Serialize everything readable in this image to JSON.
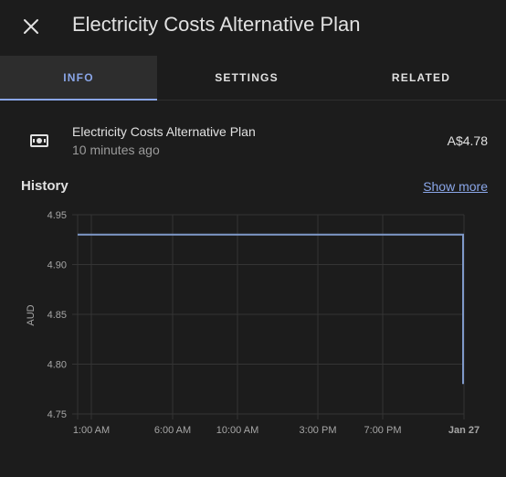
{
  "header": {
    "title": "Electricity Costs Alternative Plan",
    "close_icon": "close-icon"
  },
  "tabs": [
    {
      "label": "INFO",
      "active": true
    },
    {
      "label": "SETTINGS",
      "active": false
    },
    {
      "label": "RELATED",
      "active": false
    }
  ],
  "entity": {
    "icon": "cash-icon",
    "name": "Electricity Costs Alternative Plan",
    "last_changed": "10 minutes ago",
    "state": "A$4.78"
  },
  "history": {
    "title": "History",
    "show_more": "Show more"
  },
  "colors": {
    "accent": "#8aa6e8",
    "line": "#7f99c9",
    "background": "#1c1c1c"
  },
  "chart_data": {
    "type": "line",
    "ylabel": "AUD",
    "ylim": [
      4.75,
      4.95
    ],
    "y_ticks": [
      "4.95",
      "4.90",
      "4.85",
      "4.80",
      "4.75"
    ],
    "x_ticks": [
      "1:00 AM",
      "6:00 AM",
      "10:00 AM",
      "3:00 PM",
      "7:00 PM",
      "Jan 27"
    ],
    "grid": true,
    "series": [
      {
        "values": [
          {
            "x": "00:00",
            "y": 4.93
          },
          {
            "x": "23:55",
            "y": 4.93
          },
          {
            "x": "00:00 Jan 27",
            "y": 4.78
          }
        ]
      }
    ]
  }
}
